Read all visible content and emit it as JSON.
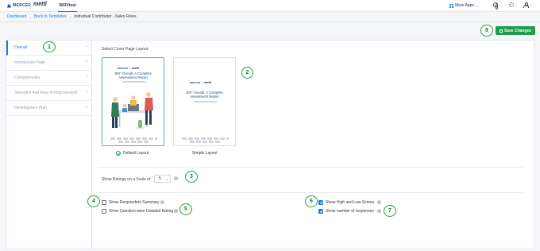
{
  "topbar": {
    "brand_mercer": "MERCER",
    "brand_mettl": "mettl",
    "app_name": "360View",
    "more_apps": "More Apps",
    "icons": [
      "apps-grid-icon",
      "globe-icon",
      "gear-icon",
      "user-icon"
    ]
  },
  "breadcrumb": {
    "items": [
      "Dashboard",
      "Back to Templates"
    ],
    "current": "Individual Contributor - Sales Roles"
  },
  "sidebar": {
    "items": [
      {
        "label": "Overall",
        "active": true
      },
      {
        "label": "Introduction Page",
        "active": false
      },
      {
        "label": "Competencies",
        "active": false
      },
      {
        "label": "Strengths And Area of Improvement",
        "active": false
      },
      {
        "label": "Development Plan",
        "active": false
      }
    ]
  },
  "toolbar": {
    "save_label": "Save Changes"
  },
  "cover": {
    "section_label": "Select Cover Page Layout:",
    "layouts": [
      {
        "name": "Default Layout",
        "selected": true,
        "card_brand_mercer": "MERCER",
        "card_brand_mettl": "mettl",
        "card_title_line1": "360° Overall: A Complete",
        "card_title_line2": "Assessment Report"
      },
      {
        "name": "Simple Layout",
        "selected": false,
        "card_brand_mercer": "MERCER",
        "card_brand_mettl": "mettl",
        "card_title_line1": "360° Overall: A Complete",
        "card_title_line2": "Assessment Report"
      }
    ]
  },
  "scale": {
    "label": "Show Ratings on a Scale of:",
    "value": "5",
    "info": "?"
  },
  "options": [
    {
      "label": "Show Respondent Summary",
      "checked": false
    },
    {
      "label": "Show Question-wise Detailed Rating",
      "checked": false
    },
    {
      "label": "Show High and Low Scores",
      "checked": true
    },
    {
      "label": "Show number of responses",
      "checked": true
    }
  ],
  "callouts": [
    "1",
    "2",
    "3",
    "4",
    "5",
    "6",
    "7",
    "8"
  ],
  "colors": {
    "accent": "#1b7bd6",
    "save_green": "#1e9e4a",
    "callout_green": "#22a23e",
    "page_bg": "#f4f6f9"
  }
}
